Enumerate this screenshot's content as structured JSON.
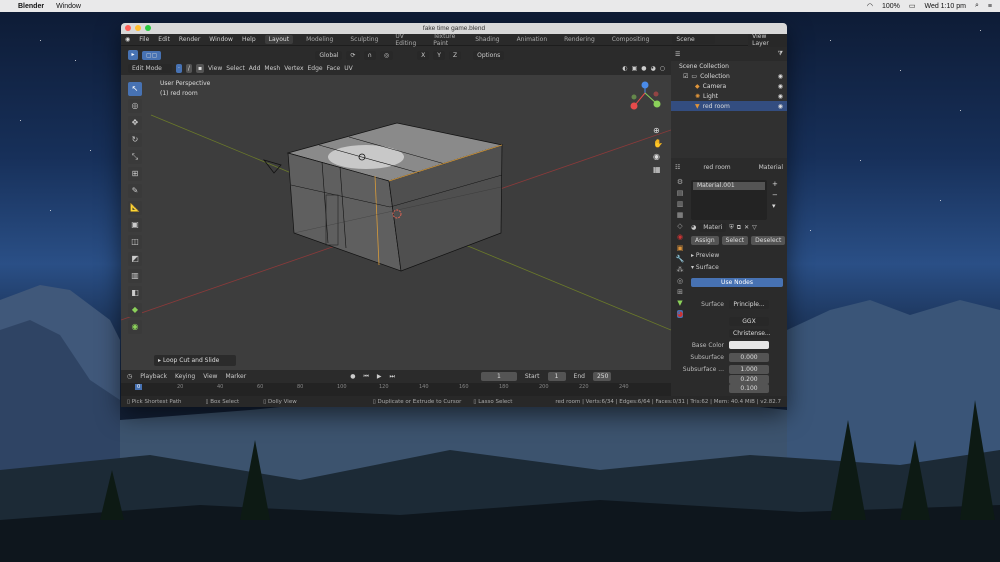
{
  "menubar": {
    "app": "Blender",
    "window": "Window",
    "time": "Wed 1:10 pm",
    "battery": "100%",
    "icons": [
      "apple-icon",
      "wifi-icon",
      "battery-icon",
      "search-icon",
      "control-center-icon"
    ]
  },
  "window": {
    "title": "fake time game.blend",
    "menus": [
      "File",
      "Edit",
      "Render",
      "Window",
      "Help"
    ],
    "workspaces": [
      "Layout",
      "Modeling",
      "Sculpting",
      "UV Editing",
      "Texture Paint",
      "Shading",
      "Animation",
      "Rendering",
      "Compositing"
    ],
    "scene": "Scene",
    "view_layer": "View Layer"
  },
  "header": {
    "transform": "Global",
    "options": "Options",
    "x": "X",
    "y": "Y",
    "z": "Z"
  },
  "viewport_header": {
    "mode": "Edit Mode",
    "menus": [
      "View",
      "Select",
      "Add",
      "Mesh",
      "Vertex",
      "Edge",
      "Face",
      "UV"
    ]
  },
  "viewport": {
    "perspective": "User Perspective",
    "object": "(1) red room",
    "operator_panel": "Loop Cut and Slide"
  },
  "outliner": {
    "root": "Scene Collection",
    "items": [
      {
        "label": "Collection"
      },
      {
        "label": "Camera"
      },
      {
        "label": "Light"
      },
      {
        "label": "red room"
      }
    ]
  },
  "properties": {
    "object": "red room",
    "material_tab": "Material",
    "slot": "Material.001",
    "material_name": "Materi",
    "assign": "Assign",
    "select": "Select",
    "deselect": "Deselect",
    "preview": "Preview",
    "surface_section": "Surface",
    "use_nodes": "Use Nodes",
    "surface_label": "Surface",
    "surface_value": "Principle...",
    "dist": "GGX",
    "sss": "Christense...",
    "base_color_label": "Base Color",
    "base_color": "#e6e6e6",
    "subsurface_label": "Subsurface",
    "subsurface_value": "0.000",
    "subsurface2_label": "Subsurface ...",
    "sub_vals": [
      "1.000",
      "0.200",
      "0.100"
    ]
  },
  "timeline": {
    "menus": [
      "Playback",
      "Keying",
      "View",
      "Marker"
    ],
    "current": "1",
    "start_label": "Start",
    "start": "1",
    "end_label": "End",
    "end": "250",
    "ruler": [
      "0",
      "20",
      "40",
      "60",
      "80",
      "100",
      "120",
      "140",
      "160",
      "180",
      "200",
      "220",
      "240"
    ]
  },
  "status": {
    "items": [
      "Pick Shortest Path",
      "Box Select",
      "Dolly View",
      "Duplicate or Extrude to Cursor",
      "Lasso Select"
    ],
    "stats": "red room | Verts:6/34 | Edges:6/64 | Faces:0/31 | Tris:62 | Mem: 40.4 MiB | v2.82.7"
  },
  "colors": {
    "accent": "#4772b3",
    "selected_row": "#334d80",
    "axis_x": "#e84b4b",
    "axis_y": "#8bd15a",
    "axis_z": "#4a8be8"
  }
}
